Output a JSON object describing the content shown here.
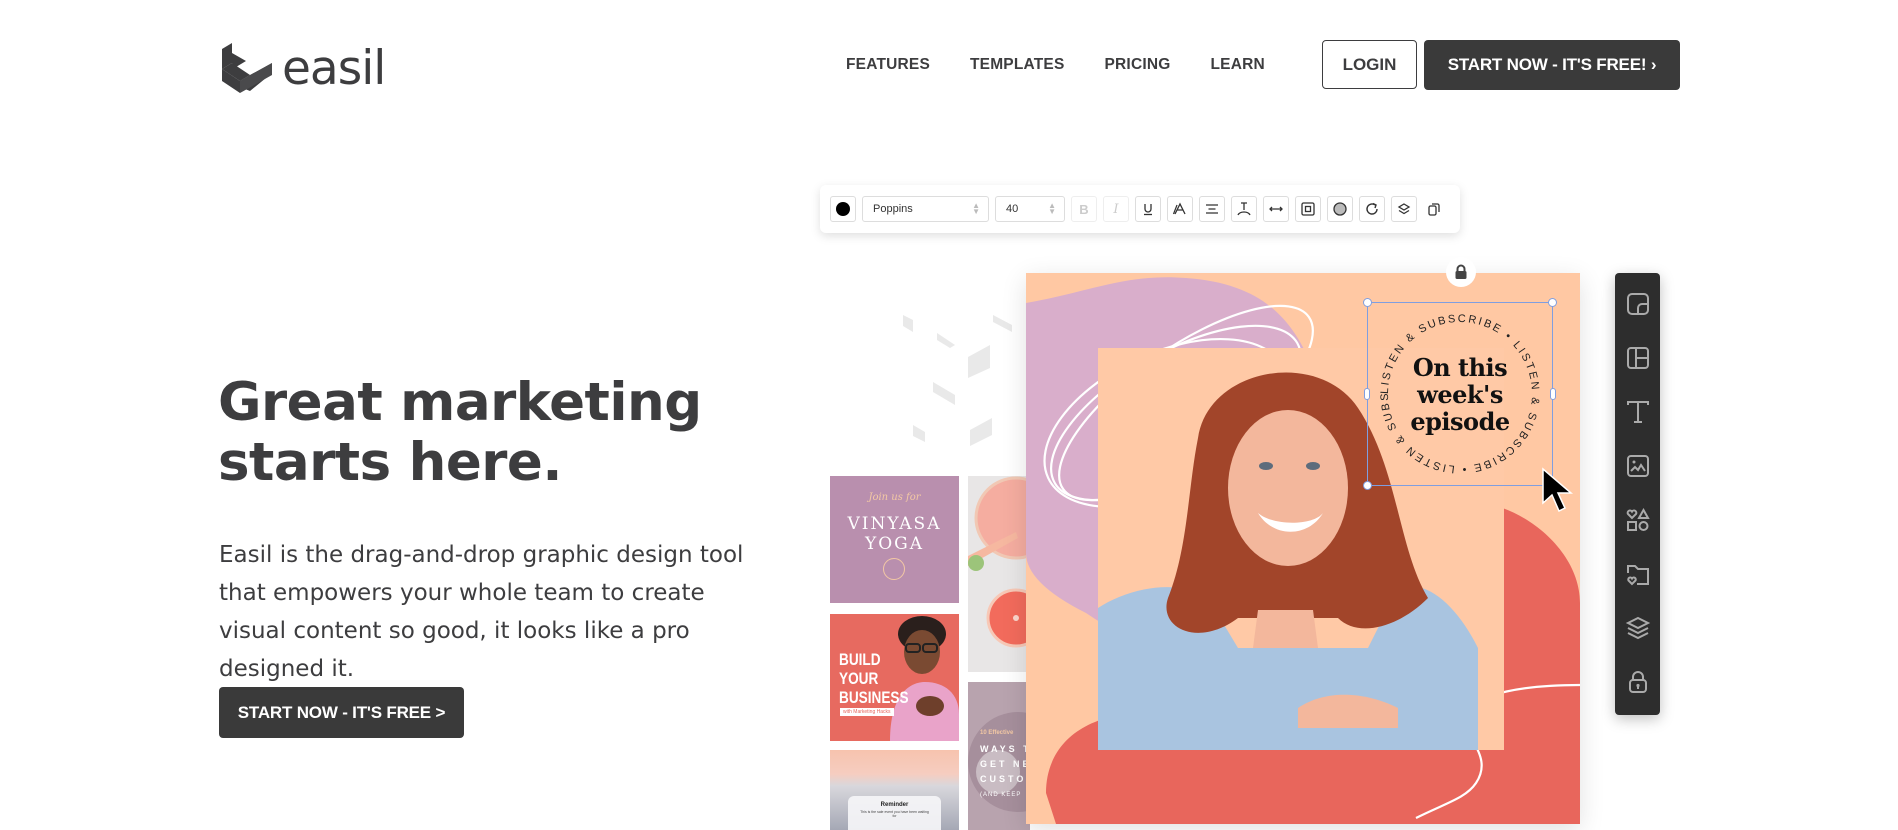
{
  "brand": {
    "name": "easil",
    "logo_icon": "easil-cube-logo"
  },
  "nav": {
    "links": [
      "FEATURES",
      "TEMPLATES",
      "PRICING",
      "LEARN"
    ],
    "login_label": "LOGIN",
    "cta_label": "START NOW - IT'S FREE! ›"
  },
  "hero": {
    "title_line1": "Great marketing",
    "title_line2": "starts here.",
    "description": "Easil is the drag-and-drop graphic design tool that empowers your whole team to create visual content so good, it looks like a pro designed it.",
    "cta_label": "START NOW - IT'S FREE >"
  },
  "editor": {
    "toolbar": {
      "text_color": "#000000",
      "font_family": "Poppins",
      "font_size": "40",
      "buttons": [
        {
          "name": "bold",
          "label": "B",
          "disabled": true
        },
        {
          "name": "italic",
          "label": "I",
          "disabled": true
        },
        {
          "name": "underline",
          "icon": "underline-icon"
        },
        {
          "name": "text-effects",
          "icon": "text-effects-icon"
        },
        {
          "name": "align",
          "icon": "align-center-icon"
        },
        {
          "name": "line-height",
          "icon": "line-height-icon"
        },
        {
          "name": "letter-spacing",
          "icon": "letter-spacing-icon"
        },
        {
          "name": "padding",
          "icon": "padding-icon"
        },
        {
          "name": "opacity",
          "icon": "opacity-icon"
        },
        {
          "name": "rotate",
          "icon": "rotate-icon"
        },
        {
          "name": "layers",
          "icon": "layers-icon"
        },
        {
          "name": "duplicate",
          "icon": "duplicate-icon"
        }
      ]
    },
    "canvas": {
      "badge_ring_text": "LISTEN & SUBSCRIBE • LISTEN & SUBSCRIBE • LISTEN & SUBSCRIBE • ",
      "badge_line1": "On this",
      "badge_line2": "week's",
      "badge_line3": "episode",
      "colors": {
        "background": "#ffc8a3",
        "lilac": "#d9aecb",
        "coral": "#e8665c",
        "selection": "#7f9ee0"
      }
    },
    "side_tools": [
      {
        "name": "templates",
        "icon": "templates-icon"
      },
      {
        "name": "layouts",
        "icon": "layouts-icon"
      },
      {
        "name": "text",
        "icon": "text-icon"
      },
      {
        "name": "photos",
        "icon": "image-icon"
      },
      {
        "name": "shapes",
        "icon": "shapes-icon"
      },
      {
        "name": "my-assets",
        "icon": "folder-heart-icon"
      },
      {
        "name": "layers",
        "icon": "layers-icon"
      },
      {
        "name": "brand-kit",
        "icon": "lock-icon"
      }
    ]
  },
  "templates": {
    "yoga": {
      "script": "Join us for",
      "title1": "VINYASA",
      "title2": "YOGA"
    },
    "business": {
      "title1": "BUILD",
      "title2": "YOUR",
      "title3": "BUSINESS",
      "sub": "with Marketing Hacks"
    },
    "ways": {
      "tag": "10 Effective",
      "line1": "WAYS T",
      "line2": "GET NE",
      "line3": "CUSTO",
      "small": "(AND KEEP"
    },
    "reminder": {
      "title": "Reminder",
      "body": "This is the sale event you have been waiting for"
    }
  }
}
